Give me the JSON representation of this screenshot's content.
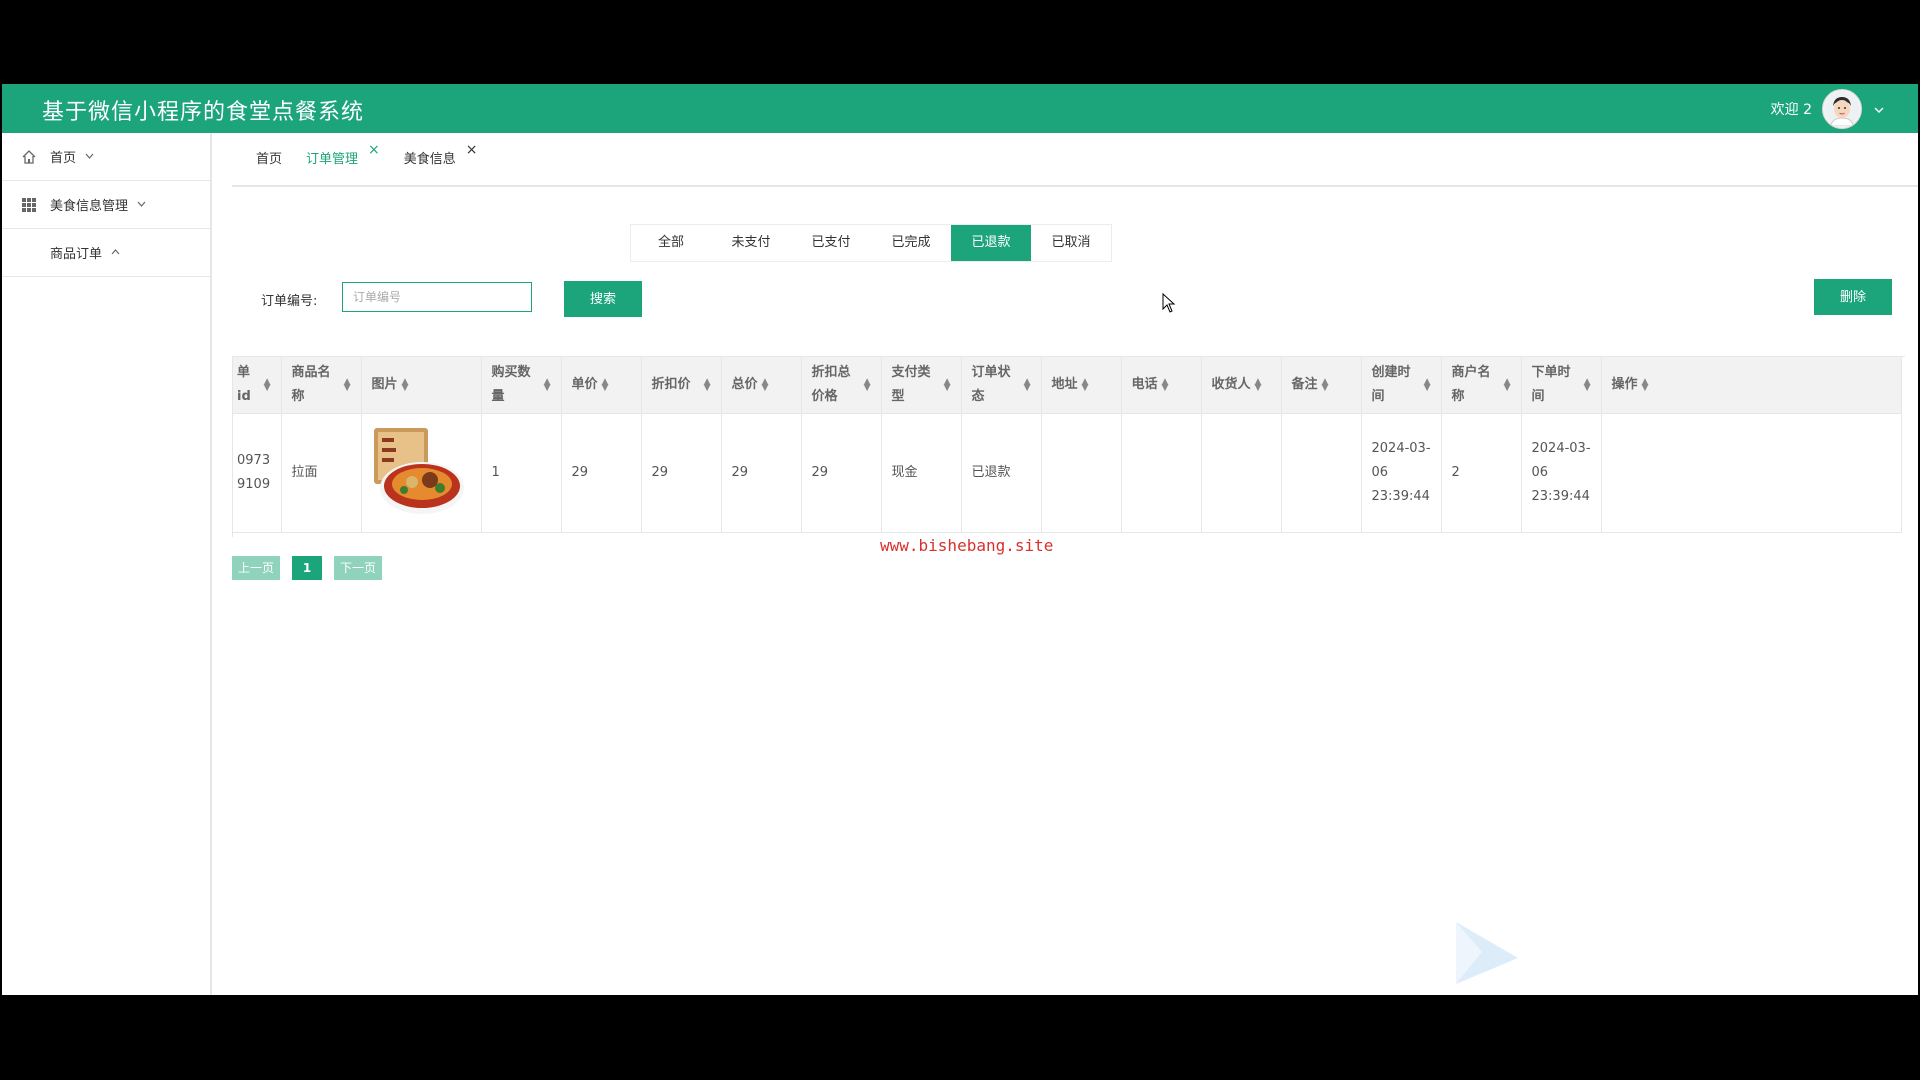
{
  "header": {
    "title": "基于微信小程序的食堂点餐系统",
    "welcome": "欢迎 2"
  },
  "sidebar": {
    "items": [
      {
        "label": "首页"
      },
      {
        "label": "美食信息管理"
      },
      {
        "label": "商品订单"
      }
    ]
  },
  "tabs": [
    {
      "label": "首页"
    },
    {
      "label": "订单管理"
    },
    {
      "label": "美食信息"
    }
  ],
  "status_filters": [
    "全部",
    "未支付",
    "已支付",
    "已完成",
    "已退款",
    "已取消"
  ],
  "status_active": "已退款",
  "search": {
    "label": "订单编号:",
    "placeholder": "订单编号",
    "button": "搜索"
  },
  "delete_button": "删除",
  "table": {
    "headers": [
      "单id",
      "商品名称",
      "图片",
      "购买数量",
      "单价",
      "折扣价",
      "总价",
      "折扣总价格",
      "支付类型",
      "订单状态",
      "地址",
      "电话",
      "收货人",
      "备注",
      "创建时间",
      "商户名称",
      "下单时间",
      "操作"
    ],
    "rows": [
      {
        "id": "09739109",
        "name": "拉面",
        "qty": "1",
        "price": "29",
        "discount_price": "29",
        "total": "29",
        "discount_total": "29",
        "pay_type": "现金",
        "status": "已退款",
        "address": "",
        "phone": "",
        "receiver": "",
        "note": "",
        "created": "2024-03-06 23:39:44",
        "merchant": "2",
        "ordered": "2024-03-06 23:39:44"
      }
    ]
  },
  "pagination": {
    "prev": "上一页",
    "current": "1",
    "next": "下一页"
  },
  "watermark": "www.bishebang.site",
  "colors": {
    "primary": "#1ca57a",
    "primary_light": "#8fd3bc",
    "watermark": "#d9302c"
  }
}
